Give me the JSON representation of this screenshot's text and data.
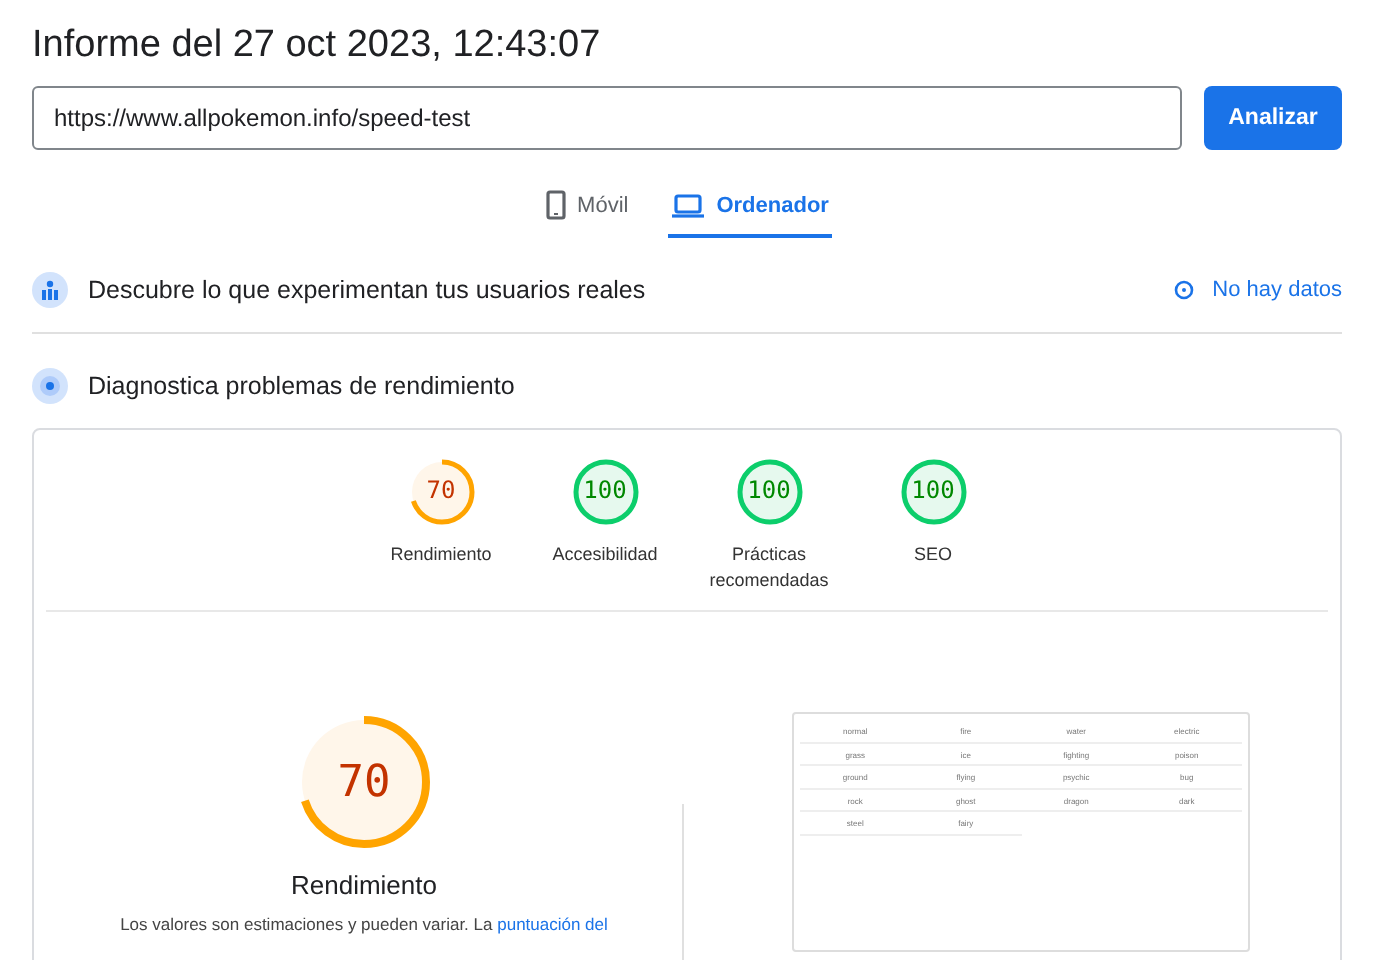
{
  "title": "Informe del 27 oct 2023, 12:43:07",
  "url_field": {
    "value": "https://www.allpokemon.info/speed-test"
  },
  "analyze_button": "Analizar",
  "device_tabs": [
    {
      "label": "Móvil",
      "kind": "phone",
      "selected": false
    },
    {
      "label": "Ordenador",
      "kind": "desktop",
      "selected": true
    }
  ],
  "field_data": {
    "title": "Descubre lo que experimentan tus usuarios reales",
    "status": "No hay datos"
  },
  "diagnostics": {
    "title": "Diagnostica problemas de rendimiento"
  },
  "scores": [
    {
      "score": "70",
      "label": "Rendimiento",
      "level": 0.7
    },
    {
      "score": "100",
      "label": "Accesibilidad",
      "level": 1
    },
    {
      "score": "100",
      "label": "Prácticas recomendadas",
      "level": 1
    },
    {
      "score": "100",
      "label": "SEO",
      "level": 1
    }
  ],
  "performance": {
    "score": "70",
    "level": 0.7,
    "title": "Rendimiento",
    "text": "Los valores son estimaciones y pueden variar. La ",
    "link": "puntuación del"
  },
  "screenshot_cells": [
    "normal",
    "fire",
    "water",
    "electric",
    "grass",
    "ice",
    "fighting",
    "poison",
    "ground",
    "flying",
    "psychic",
    "bug",
    "rock",
    "ghost",
    "dragon",
    "dark",
    "steel",
    "fairy"
  ]
}
